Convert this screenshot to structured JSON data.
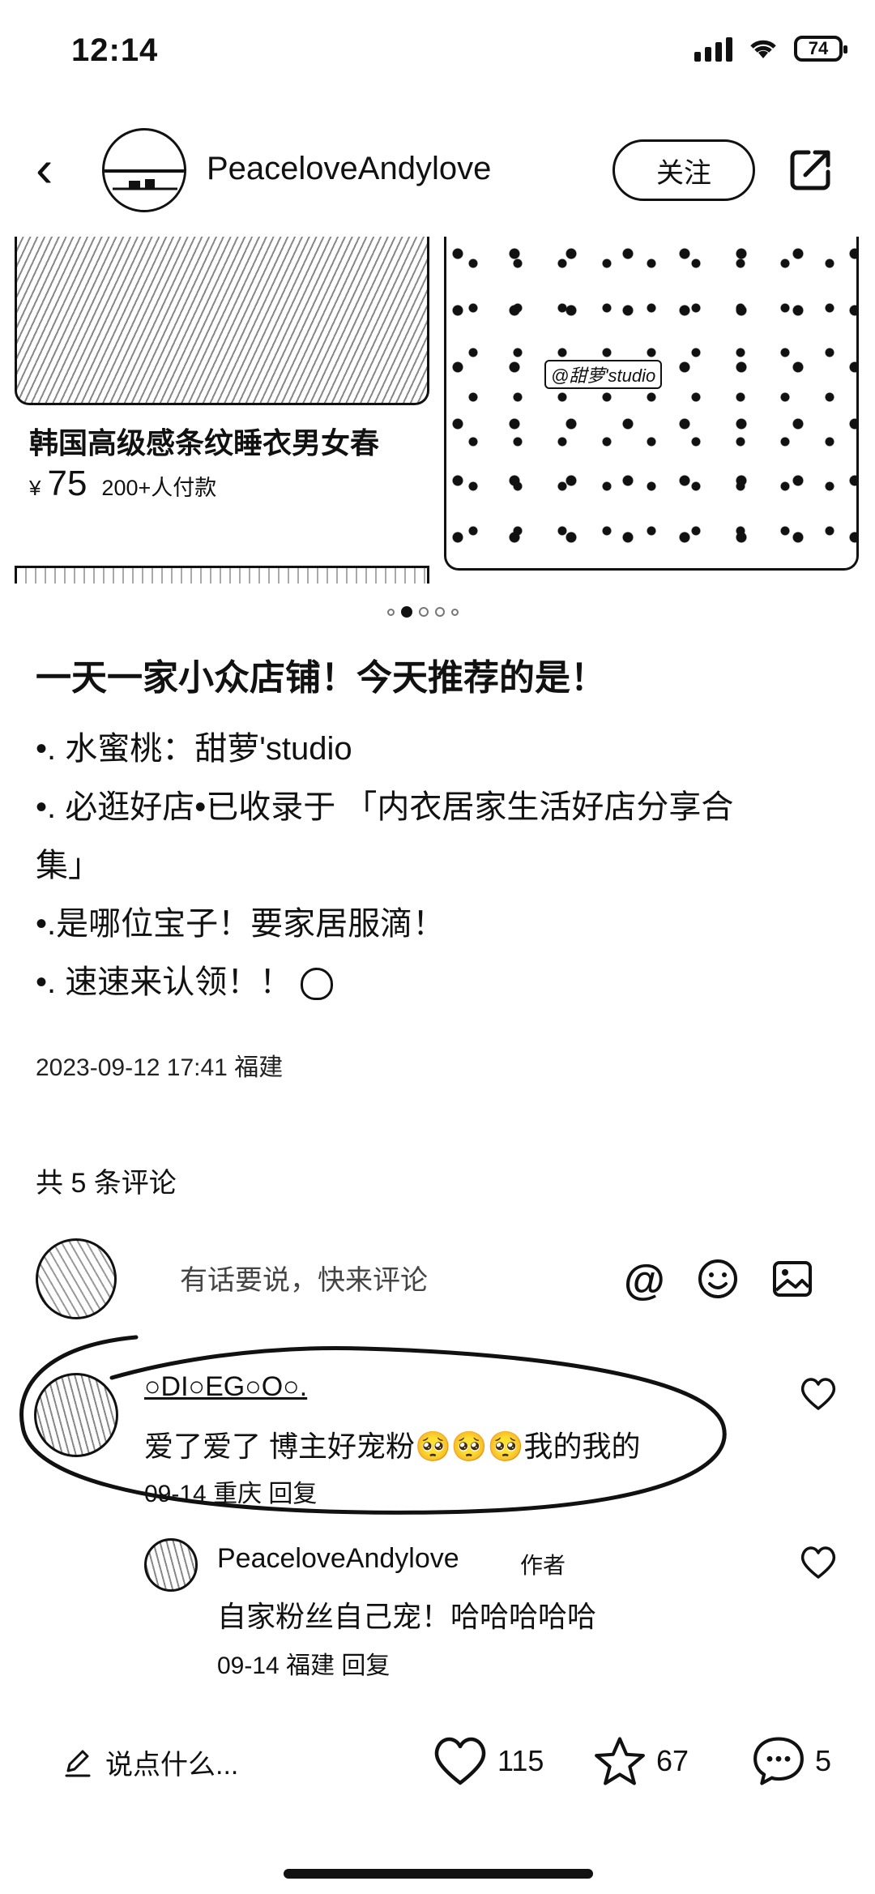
{
  "status_bar": {
    "time": "12:14",
    "battery": "74"
  },
  "header": {
    "author": "PeaceloveAndylove",
    "follow_label": "关注"
  },
  "product": {
    "title": "韩国高级感条纹睡衣男女春",
    "currency": "¥",
    "price": "75",
    "sold": "200+人付款",
    "watermark": "@甜萝'studio"
  },
  "post": {
    "title": "一天一家小众店铺！今天推荐的是！",
    "lines": [
      "•. 水蜜桃：甜萝'studio",
      "•. 必逛好店•已收录于 「内衣居家生活好店分享合",
      "集」",
      "•.是哪位宝子！要家居服滴！",
      "•. 速速来认领！！"
    ],
    "date": "2023-09-12 17:41 福建"
  },
  "comments_section": {
    "count_label": "共 5 条评论",
    "input_placeholder": "有话要说，快来评论"
  },
  "comments": [
    {
      "name": "○DI○EG○O○.",
      "text": "爱了爱了 博主好宠粉🥺🥺🥺我的我的",
      "meta": "09-14 重庆 回复"
    }
  ],
  "reply": {
    "name": "PeaceloveAndylove",
    "tag": "作者",
    "text": "自家粉丝自己宠！哈哈哈哈哈",
    "meta": "09-14 福建 回复"
  },
  "bottom_bar": {
    "compose_label": "说点什么...",
    "likes": "115",
    "stars": "67",
    "comments": "5"
  }
}
